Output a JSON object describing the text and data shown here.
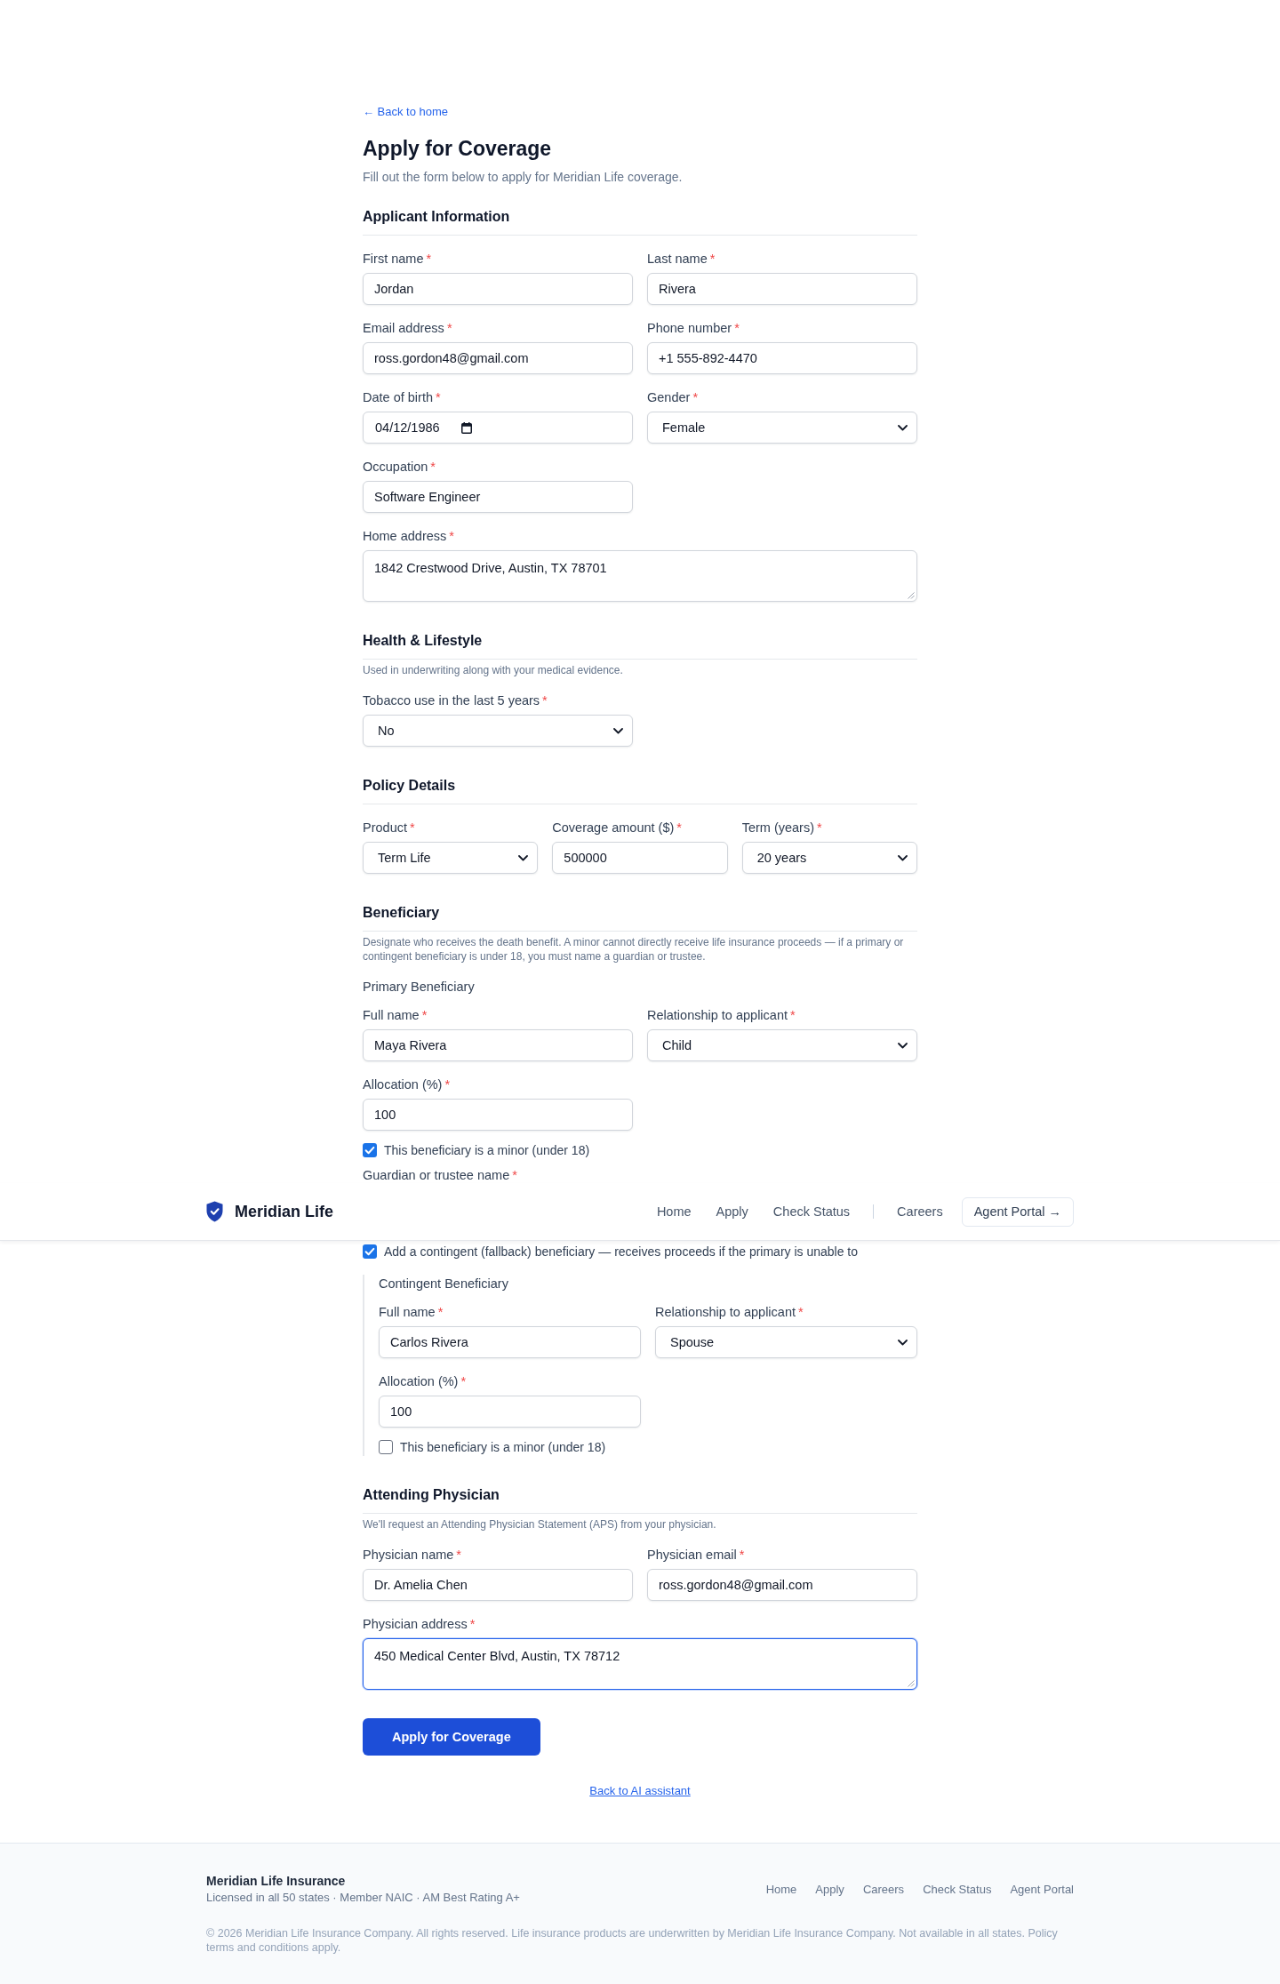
{
  "back_link": "← Back to home",
  "title": "Apply for Coverage",
  "subtitle": "Fill out the form below to apply for Meridian Life coverage.",
  "sections": [
    {
      "heading": "Applicant Information",
      "items": [
        {
          "kind": "pair",
          "fields": [
            {
              "kind": "text",
              "label": "First name",
              "required_mark": "*",
              "value": "Jordan"
            },
            {
              "kind": "text",
              "label": "Last name",
              "required_mark": "*",
              "value": "Rivera"
            }
          ]
        },
        {
          "kind": "pair",
          "fields": [
            {
              "kind": "text",
              "label": "Email address",
              "required_mark": "*",
              "value": "ross.gordon48@gmail.com"
            },
            {
              "kind": "text",
              "label": "Phone number",
              "required_mark": "*",
              "value": "+1 555-892-4470"
            }
          ]
        },
        {
          "kind": "pair",
          "fields": [
            {
              "kind": "date",
              "label": "Date of birth",
              "required_mark": "*",
              "value": "04/12/1986"
            },
            {
              "kind": "select",
              "label": "Gender",
              "required_mark": "*",
              "value": "Female"
            }
          ]
        },
        {
          "kind": "pair",
          "fields": [
            {
              "kind": "text",
              "label": "Occupation",
              "required_mark": "*",
              "value": "Software Engineer"
            }
          ]
        },
        {
          "kind": "wide",
          "fields": [
            {
              "kind": "textarea",
              "label": "Home address",
              "required_mark": "*",
              "value": "1842 Crestwood Drive, Austin, TX 78701",
              "focused": false
            }
          ]
        }
      ]
    },
    {
      "heading": "Health & Lifestyle",
      "hint": "Used in underwriting along with your medical evidence.",
      "items": [
        {
          "kind": "pair",
          "fields": [
            {
              "kind": "select",
              "label": "Tobacco use in the last 5 years",
              "required_mark": "*",
              "value": "No"
            }
          ]
        }
      ]
    },
    {
      "heading": "Policy Details",
      "items": [
        {
          "kind": "triple",
          "fields": [
            {
              "kind": "select",
              "label": "Product",
              "required_mark": "*",
              "value": "Term Life"
            },
            {
              "kind": "text",
              "label": "Coverage amount ($)",
              "required_mark": "*",
              "value": "500000"
            },
            {
              "kind": "select",
              "label": "Term (years)",
              "required_mark": "*",
              "value": "20 years"
            }
          ]
        }
      ]
    },
    {
      "heading": "Beneficiary",
      "hint": "Designate who receives the death benefit. A minor cannot directly receive life insurance proceeds — if a primary or contingent beneficiary is under 18, you must name a guardian or trustee.",
      "items": [
        {
          "kind": "subheading",
          "text": "Primary Beneficiary"
        },
        {
          "kind": "pair",
          "fields": [
            {
              "kind": "text",
              "label": "Full name",
              "required_mark": "*",
              "value": "Maya Rivera"
            },
            {
              "kind": "select",
              "label": "Relationship to applicant",
              "required_mark": "*",
              "value": "Child"
            }
          ]
        },
        {
          "kind": "pair",
          "fields": [
            {
              "kind": "text",
              "label": "Allocation (%)",
              "required_mark": "*",
              "value": "100"
            }
          ]
        },
        {
          "kind": "checkbox",
          "label": "This beneficiary is a minor (under 18)",
          "checked": true
        },
        {
          "kind": "covered",
          "label": "Guardian or trustee name",
          "required_mark": "*"
        },
        {
          "kind": "checkbox",
          "label": "Add a contingent (fallback) beneficiary — receives proceeds if the primary is unable to",
          "checked": true
        },
        {
          "kind": "panel",
          "items": [
            {
              "kind": "subheading",
              "text": "Contingent Beneficiary"
            },
            {
              "kind": "pair",
              "fields": [
                {
                  "kind": "text",
                  "label": "Full name",
                  "required_mark": "*",
                  "value": "Carlos Rivera"
                },
                {
                  "kind": "select",
                  "label": "Relationship to applicant",
                  "required_mark": "*",
                  "value": "Spouse"
                }
              ]
            },
            {
              "kind": "pair",
              "fields": [
                {
                  "kind": "text",
                  "label": "Allocation (%)",
                  "required_mark": "*",
                  "value": "100"
                }
              ]
            },
            {
              "kind": "checkbox",
              "label": "This beneficiary is a minor (under 18)",
              "checked": false
            }
          ]
        }
      ]
    },
    {
      "heading": "Attending Physician",
      "hint": "We'll request an Attending Physician Statement (APS) from your physician.",
      "items": [
        {
          "kind": "pair",
          "fields": [
            {
              "kind": "text",
              "label": "Physician name",
              "required_mark": "*",
              "value": "Dr. Amelia Chen"
            },
            {
              "kind": "text",
              "label": "Physician email",
              "required_mark": "*",
              "value": "ross.gordon48@gmail.com"
            }
          ]
        },
        {
          "kind": "wide",
          "fields": [
            {
              "kind": "textarea",
              "label": "Physician address",
              "required_mark": "*",
              "value": "450 Medical Center Blvd, Austin, TX 78712",
              "focused": true
            }
          ]
        }
      ]
    }
  ],
  "submit_button": "Apply for Coverage",
  "assistant_link": "Back to AI assistant",
  "header": {
    "brand": "Meridian Life",
    "nav_groups": [
      {
        "links": [
          "Home",
          "Apply",
          "Check Status"
        ]
      },
      {
        "links": [
          "Careers"
        ]
      }
    ],
    "portal_button": "Agent Portal →"
  },
  "footer": {
    "title": "Meridian Life Insurance",
    "tagline": "Licensed in all 50 states · Member NAIC · AM Best Rating A+",
    "links": [
      "Home",
      "Apply",
      "Careers",
      "Check Status",
      "Agent Portal"
    ],
    "copyright": "© 2026 Meridian Life Insurance Company. All rights reserved. Life insurance products are underwritten by Meridian Life Insurance Company. Not available in all states. Policy terms and conditions apply."
  }
}
